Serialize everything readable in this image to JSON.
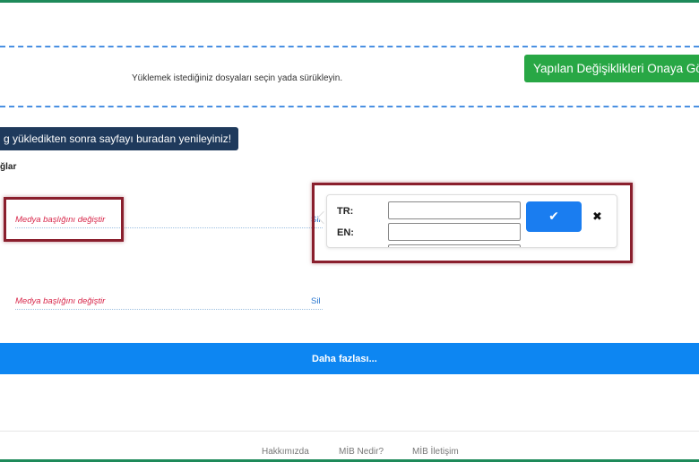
{
  "upload": {
    "hint": "Yüklemek istediğiniz dosyaları seçin yada sürükleyin.",
    "approve_button": "Yapılan Değişiklikleri Onaya Gönder"
  },
  "notice": {
    "refresh_text": "g yükledikten sonra sayfayı buradan yenileyiniz!"
  },
  "section": {
    "label": "ğlar"
  },
  "media": {
    "items": [
      {
        "title": "Medya başlığını değiştir",
        "delete_label": "Sil"
      },
      {
        "title": "Medya başlığını değiştir",
        "delete_label": "Sil"
      }
    ]
  },
  "edit_popup": {
    "tr_label": "TR:",
    "en_label": "EN:",
    "tr_value": "",
    "en_value": "",
    "confirm_icon": "check-icon",
    "cancel_icon": "close-icon",
    "confirm_glyph": "✔",
    "cancel_glyph": "✖"
  },
  "more_button": "Daha fazlası...",
  "footer": {
    "links": [
      "Hakkımızda",
      "MİB Nedir?",
      "MİB İletişim"
    ]
  },
  "colors": {
    "accent_green": "#28a745",
    "primary_blue": "#0d86f2",
    "highlight_border": "#8a1f2d",
    "media_title": "#d8274a",
    "notice_bg": "#1f3a5c"
  }
}
